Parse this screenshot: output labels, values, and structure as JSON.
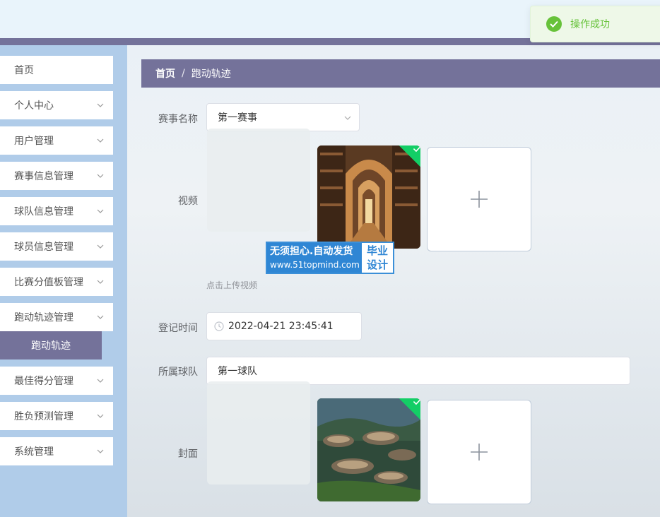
{
  "toast": {
    "message": "操作成功",
    "color": "#67c23a"
  },
  "sidebar": {
    "items": [
      {
        "label": "首页"
      },
      {
        "label": "个人中心"
      },
      {
        "label": "用户管理"
      },
      {
        "label": "赛事信息管理"
      },
      {
        "label": "球队信息管理"
      },
      {
        "label": "球员信息管理"
      },
      {
        "label": "比赛分值板管理"
      },
      {
        "label": "跑动轨迹管理"
      },
      {
        "label": "最佳得分管理"
      },
      {
        "label": "胜负预测管理"
      },
      {
        "label": "系统管理"
      }
    ],
    "active_sub": "跑动轨迹"
  },
  "breadcrumb": {
    "home": "首页",
    "sep": "/",
    "current": "跑动轨迹"
  },
  "form": {
    "event_label": "赛事名称",
    "event_value": "第一赛事",
    "video_label": "视频",
    "video_hint": "点击上传视频",
    "time_label": "登记时间",
    "time_value": "2022-04-21 23:45:41",
    "team_label": "所属球队",
    "team_value": "第一球队",
    "cover_label": "封面"
  },
  "watermark": {
    "line1": "无须担心.自动发货",
    "line2": "www.51topmind.com",
    "right1": "毕业",
    "right2": "设计"
  },
  "colors": {
    "accent": "#74729a",
    "sidebar_bg": "#b0cce9",
    "success": "#13ce66"
  }
}
